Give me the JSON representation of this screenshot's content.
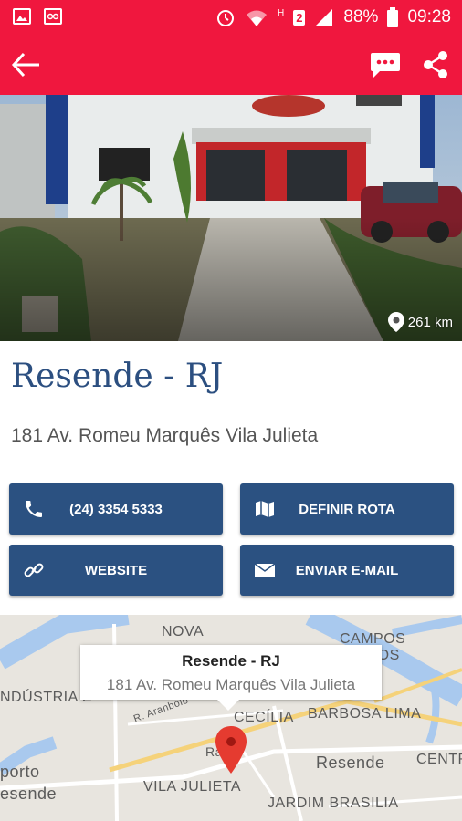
{
  "status_bar": {
    "battery": "88%",
    "time": "09:28",
    "sim": "2",
    "network": "H"
  },
  "app_bar": {
    "back_icon": "arrow-left-icon",
    "chat_icon": "chat-bubble-icon",
    "share_icon": "share-icon"
  },
  "place": {
    "distance": "261 km",
    "title": "Resende - RJ",
    "address": "181 Av. Romeu Marquês Vila Julieta"
  },
  "actions": {
    "phone": "(24) 3354 5333",
    "route": "DEFINIR ROTA",
    "website": "WEBSITE",
    "email": "ENVIAR E-MAIL"
  },
  "map": {
    "bubble_title": "Resende - RJ",
    "bubble_address": "181 Av. Romeu Marquês Vila Julieta",
    "labels": {
      "nova": "NOVA",
      "campos": "CAMPOS ELÍSIOS",
      "industria": "NDÚSTRIA E",
      "cecilia": "CECÍLIA",
      "barbosa": "BARBOSA LIMA",
      "resende": "Resende",
      "centro": "CENTR",
      "porto": "porto",
      "esende": "esende",
      "vila": "VILA JULIETA",
      "jardim": "JARDIM BRASILIA",
      "ra": "Ra",
      "rua": "R. Aranbolo"
    }
  },
  "colors": {
    "accent": "#f0173e",
    "primary": "#2b5181",
    "title": "#2c4f80"
  }
}
